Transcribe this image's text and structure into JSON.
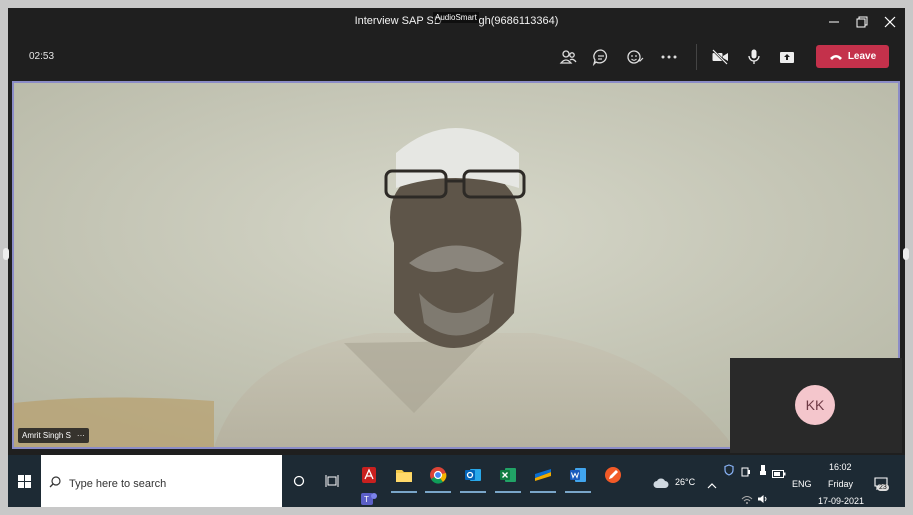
{
  "window": {
    "title": "Interview SAP SD",
    "title_suffix": "gh(9686113364)",
    "overlay_tag": "AudioSmart"
  },
  "toolbar": {
    "timer": "02:53",
    "leave_label": "Leave",
    "icons": [
      "participants-icon",
      "chat-icon",
      "reactions-icon",
      "more-icon",
      "camera-off-icon",
      "mic-icon",
      "share-icon"
    ]
  },
  "participant": {
    "name": "Amrit Singh S",
    "more": "···"
  },
  "self_preview": {
    "initials": "KK",
    "avatar_color": "#f4c6cc"
  },
  "taskbar": {
    "search_placeholder": "Type here to search",
    "weather": "26°C",
    "language": "ENG",
    "time": "16:02",
    "day": "Friday",
    "date": "17-09-2021",
    "notifications": "23"
  },
  "colors": {
    "leave": "#c4314b",
    "stage_border": "#8b8cc7",
    "taskbar": "#1d2a34"
  }
}
